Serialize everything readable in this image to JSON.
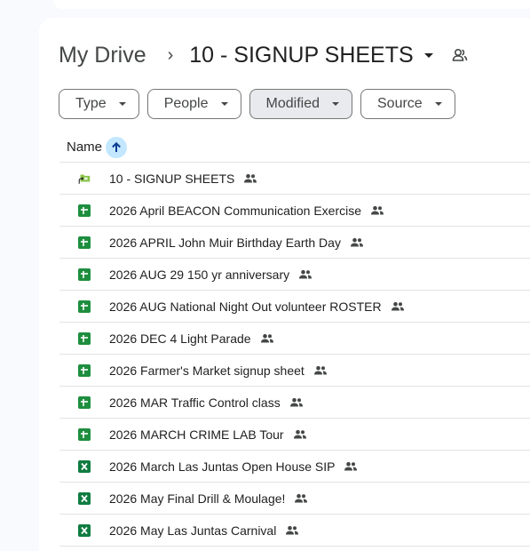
{
  "breadcrumb": {
    "root": "My Drive",
    "separator": "›",
    "current": "10 - SIGNUP SHEETS"
  },
  "filters": [
    {
      "label": "Type",
      "active": false
    },
    {
      "label": "People",
      "active": false
    },
    {
      "label": "Modified",
      "active": true
    },
    {
      "label": "Source",
      "active": false
    }
  ],
  "list": {
    "name_header": "Name",
    "sort": "ascending",
    "items": [
      {
        "name": "10 - SIGNUP SHEETS",
        "type": "shortcut-folder",
        "shared": true
      },
      {
        "name": "2026  April BEACON Communication Exercise",
        "type": "google-sheets",
        "shared": true
      },
      {
        "name": "2026 APRIL John Muir Birthday Earth Day",
        "type": "google-sheets",
        "shared": true
      },
      {
        "name": "2026 AUG 29 150 yr anniversary",
        "type": "google-sheets",
        "shared": true
      },
      {
        "name": "2026 AUG National Night Out volunteer ROSTER",
        "type": "google-sheets",
        "shared": true
      },
      {
        "name": "2026 DEC 4 Light Parade",
        "type": "google-sheets",
        "shared": true
      },
      {
        "name": "2026 Farmer's Market signup sheet",
        "type": "google-sheets",
        "shared": true
      },
      {
        "name": "2026 MAR Traffic Control class",
        "type": "google-sheets",
        "shared": true
      },
      {
        "name": "2026 MARCH CRIME LAB Tour",
        "type": "google-sheets",
        "shared": true
      },
      {
        "name": "2026 March Las Juntas Open House SIP",
        "type": "excel",
        "shared": true
      },
      {
        "name": "2026 May Final Drill & Moulage!",
        "type": "excel",
        "shared": true
      },
      {
        "name": "2026 May Las Juntas Carnival",
        "type": "excel",
        "shared": true
      }
    ]
  },
  "colors": {
    "sheets_green": "#1e8e3e",
    "excel_green": "#107c41",
    "sort_accent": "#c2e7ff",
    "chip_active_bg": "#e8eaed"
  }
}
